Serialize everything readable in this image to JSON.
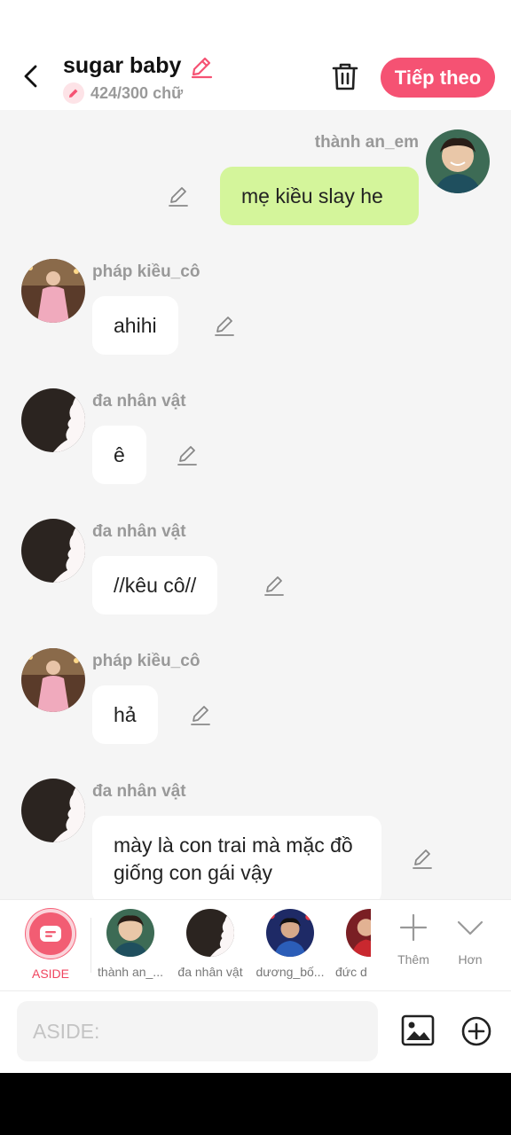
{
  "header": {
    "title": "sugar baby",
    "char_count": "424/300 chữ",
    "next_label": "Tiếp theo",
    "accent": "#f55273"
  },
  "messages": [
    {
      "sender": "thành an_em",
      "text": "mẹ kiều slay he",
      "mine": true,
      "avatar_icon": "photo-avatar-boy-icon"
    },
    {
      "sender": "pháp kiều_cô",
      "text": "ahihi",
      "mine": false,
      "avatar_icon": "photo-avatar-pink-icon"
    },
    {
      "sender": "đa nhân vật",
      "text": "ê",
      "mine": false,
      "avatar_icon": "silhouette-avatar-icon"
    },
    {
      "sender": "đa nhân vật",
      "text": "//kêu cô//",
      "mine": false,
      "avatar_icon": "silhouette-avatar-icon"
    },
    {
      "sender": "pháp kiều_cô",
      "text": "hả",
      "mine": false,
      "avatar_icon": "photo-avatar-pink-icon"
    },
    {
      "sender": "đa nhân vật",
      "text": "mày là con trai mà mặc đồ giống con gái vậy",
      "mine": false,
      "avatar_icon": "silhouette-avatar-icon"
    }
  ],
  "characters": {
    "aside_label": "ASIDE",
    "items": [
      {
        "label": "thành an_...",
        "icon": "photo-avatar-boy-icon"
      },
      {
        "label": "đa nhân vật",
        "icon": "silhouette-avatar-icon"
      },
      {
        "label": "dương_bố...",
        "icon": "photo-avatar-blue-icon"
      },
      {
        "label": "đức d",
        "icon": "photo-avatar-red-icon"
      }
    ],
    "more_label": "Thêm",
    "collapse_label": "Hơn"
  },
  "input": {
    "placeholder": "ASIDE:",
    "value": ""
  },
  "colors": {
    "mine_bubble": "#d4f59b",
    "chat_bg": "#f5f5f5"
  }
}
